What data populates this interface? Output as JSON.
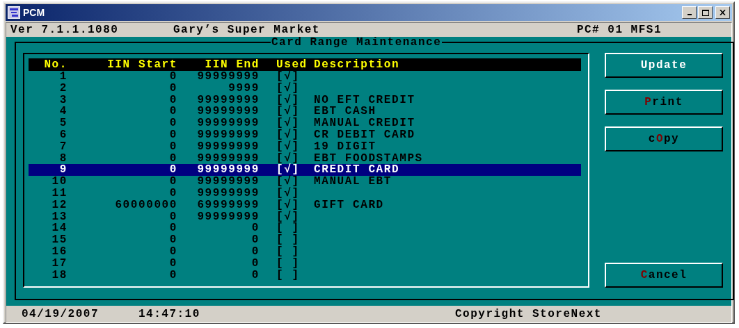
{
  "window": {
    "title": "PCM"
  },
  "info_bar": {
    "version": "Ver 7.1.1.1080",
    "store": "Gary’s Super Market",
    "station": "PC# 01 MFS1"
  },
  "panel": {
    "title": "Card Range Maintenance"
  },
  "table": {
    "columns": [
      "No.",
      "IIN Start",
      "IIN End",
      "Used",
      "Description"
    ],
    "rows": [
      {
        "no": "1",
        "iin_start": "0",
        "iin_end": "99999999",
        "used": "[√]",
        "selected": false
      },
      {
        "no": "2",
        "iin_start": "0",
        "iin_end": "9999",
        "used": "[√]",
        "selected": false
      },
      {
        "no": "3",
        "iin_start": "0",
        "iin_end": "99999999",
        "used": "[√]",
        "description": "NO EFT CREDIT",
        "selected": false
      },
      {
        "no": "4",
        "iin_start": "0",
        "iin_end": "99999999",
        "used": "[√]",
        "description": "EBT CASH",
        "selected": false
      },
      {
        "no": "5",
        "iin_start": "0",
        "iin_end": "99999999",
        "used": "[√]",
        "description": "MANUAL CREDIT",
        "selected": false
      },
      {
        "no": "6",
        "iin_start": "0",
        "iin_end": "99999999",
        "used": "[√]",
        "description": "CR DEBIT CARD",
        "selected": false
      },
      {
        "no": "7",
        "iin_start": "0",
        "iin_end": "99999999",
        "used": "[√]",
        "description": "19 DIGIT",
        "selected": false
      },
      {
        "no": "8",
        "iin_start": "0",
        "iin_end": "99999999",
        "used": "[√]",
        "description": "EBT FOODSTAMPS",
        "selected": false
      },
      {
        "no": "9",
        "iin_start": "0",
        "iin_end": "99999999",
        "used": "[√]",
        "description": "CREDIT CARD",
        "selected": true
      },
      {
        "no": "10",
        "iin_start": "0",
        "iin_end": "99999999",
        "used": "[√]",
        "description": "MANUAL EBT",
        "selected": false
      },
      {
        "no": "11",
        "iin_start": "0",
        "iin_end": "99999999",
        "used": "[√]",
        "selected": false
      },
      {
        "no": "12",
        "iin_start": "60000000",
        "iin_end": "69999999",
        "used": "[√]",
        "description": "GIFT CARD",
        "selected": false
      },
      {
        "no": "13",
        "iin_start": "0",
        "iin_end": "99999999",
        "used": "[√]",
        "selected": false
      },
      {
        "no": "14",
        "iin_start": "0",
        "iin_end": "0",
        "used": "[ ]",
        "selected": false
      },
      {
        "no": "15",
        "iin_start": "0",
        "iin_end": "0",
        "used": "[ ]",
        "selected": false
      },
      {
        "no": "16",
        "iin_start": "0",
        "iin_end": "0",
        "used": "[ ]",
        "selected": false
      },
      {
        "no": "17",
        "iin_start": "0",
        "iin_end": "0",
        "used": "[ ]",
        "selected": false
      },
      {
        "no": "18",
        "iin_start": "0",
        "iin_end": "0",
        "used": "[ ]",
        "selected": false
      }
    ]
  },
  "buttons": [
    {
      "kind": "default",
      "before": "Update"
    },
    {
      "kind": "plain",
      "key": "P",
      "after": "rint"
    },
    {
      "kind": "plain",
      "before": "c",
      "key": "O",
      "after": "py"
    },
    {
      "kind": "spacer"
    },
    {
      "kind": "plain",
      "key": "C",
      "after": "ancel"
    }
  ],
  "status_bar": {
    "date": "04/19/2007",
    "time": "14:47:10",
    "copyright": "Copyright StoreNext"
  }
}
